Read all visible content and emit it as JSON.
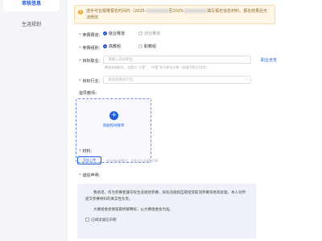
{
  "sidebar": {
    "items": [
      {
        "label": "审核信息",
        "active": true
      },
      {
        "label": "生涯规划",
        "active": false
      }
    ]
  },
  "notice": {
    "text_before": "选手可在报赛报名时间内（2025-",
    "text_middle": "至2025-",
    "text_after": "填写报名信息材料，报名结果后无法修改"
  },
  "form": {
    "competition_track": {
      "label": "参赛赛道：",
      "options": [
        {
          "label": "就业赛道",
          "selected": true
        },
        {
          "label": "创业赛道",
          "selected": false
        }
      ]
    },
    "group": {
      "label": "参赛组别：",
      "options": [
        {
          "label": "高教组",
          "selected": true
        },
        {
          "label": "职教组",
          "selected": false
        }
      ]
    },
    "target_job": {
      "label": "目标职业：",
      "placeholder": "请输入目标职业",
      "link": "职业全览",
      "hint": "需具体到职业，也是以“大类”、“中类”作为单位名称（仅填不超过15字）"
    },
    "target_industry": {
      "label": "目标行业：",
      "placeholder": "请选择目标行业"
    },
    "advisor": {
      "label": "指导教师：",
      "add_label": "添加指导教师"
    },
    "materials": {
      "label": "材料：",
      "button": "点击上传",
      "hint": "仅支持pdf格式，文件大小不超过5M"
    },
    "integrity": {
      "label": "诚信声明：",
      "para1": "我承诺，作为参赛者遵守校生涯规划参赛，如有违规则自愿接受取消参赛资格等处理，本人对所提交参赛材料的真实性负责。",
      "para2": "大赛组委会保留最终解释权，以大赛组委会为准。",
      "checkbox": "已阅读诚信声明"
    }
  }
}
